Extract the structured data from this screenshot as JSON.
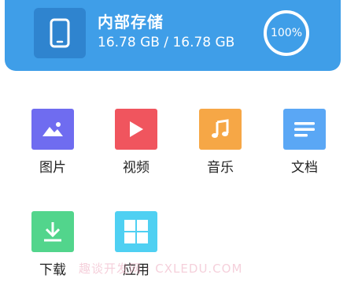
{
  "storage": {
    "title": "内部存储",
    "size_text": "16.78 GB / 16.78 GB",
    "percent_text": "100%",
    "used_fraction": 1.0,
    "icon": "phone-icon",
    "background_color": "#3f9ee8"
  },
  "categories": [
    {
      "label": "图片",
      "icon": "image-icon",
      "color": "#6f6cf0"
    },
    {
      "label": "视频",
      "icon": "play-icon",
      "color": "#f0555e"
    },
    {
      "label": "音乐",
      "icon": "music-note-icon",
      "color": "#f6a746"
    },
    {
      "label": "文档",
      "icon": "document-icon",
      "color": "#5aa7f5"
    },
    {
      "label": "下载",
      "icon": "download-icon",
      "color": "#52d58c"
    },
    {
      "label": "应用",
      "icon": "apps-grid-icon",
      "color": "#4fd0f2"
    }
  ],
  "watermark": "趣谈开发网 · CXLEDU.COM"
}
